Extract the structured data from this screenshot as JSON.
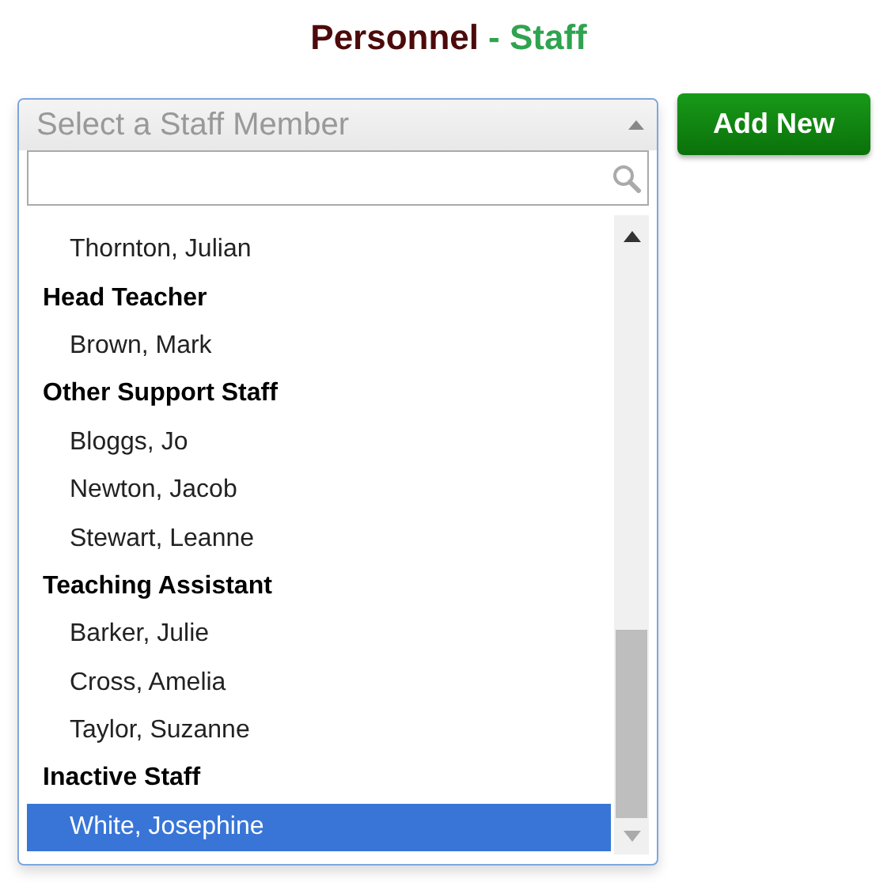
{
  "title": {
    "main": "Personnel",
    "sub": "- Staff"
  },
  "select": {
    "placeholder": "Select a Staff Member",
    "groups": [
      {
        "items": [
          {
            "name": "Thornton, Julian",
            "selected": false
          }
        ]
      },
      {
        "label": "Head Teacher",
        "items": [
          {
            "name": "Brown, Mark",
            "selected": false
          }
        ]
      },
      {
        "label": "Other Support Staff",
        "items": [
          {
            "name": "Bloggs, Jo",
            "selected": false
          },
          {
            "name": "Newton, Jacob",
            "selected": false
          },
          {
            "name": "Stewart, Leanne",
            "selected": false
          }
        ]
      },
      {
        "label": "Teaching Assistant",
        "items": [
          {
            "name": "Barker, Julie",
            "selected": false
          },
          {
            "name": "Cross, Amelia",
            "selected": false
          },
          {
            "name": "Taylor, Suzanne",
            "selected": false
          }
        ]
      },
      {
        "label": "Inactive Staff",
        "items": [
          {
            "name": "White, Josephine",
            "selected": true
          }
        ]
      }
    ]
  },
  "add_button": "Add New"
}
